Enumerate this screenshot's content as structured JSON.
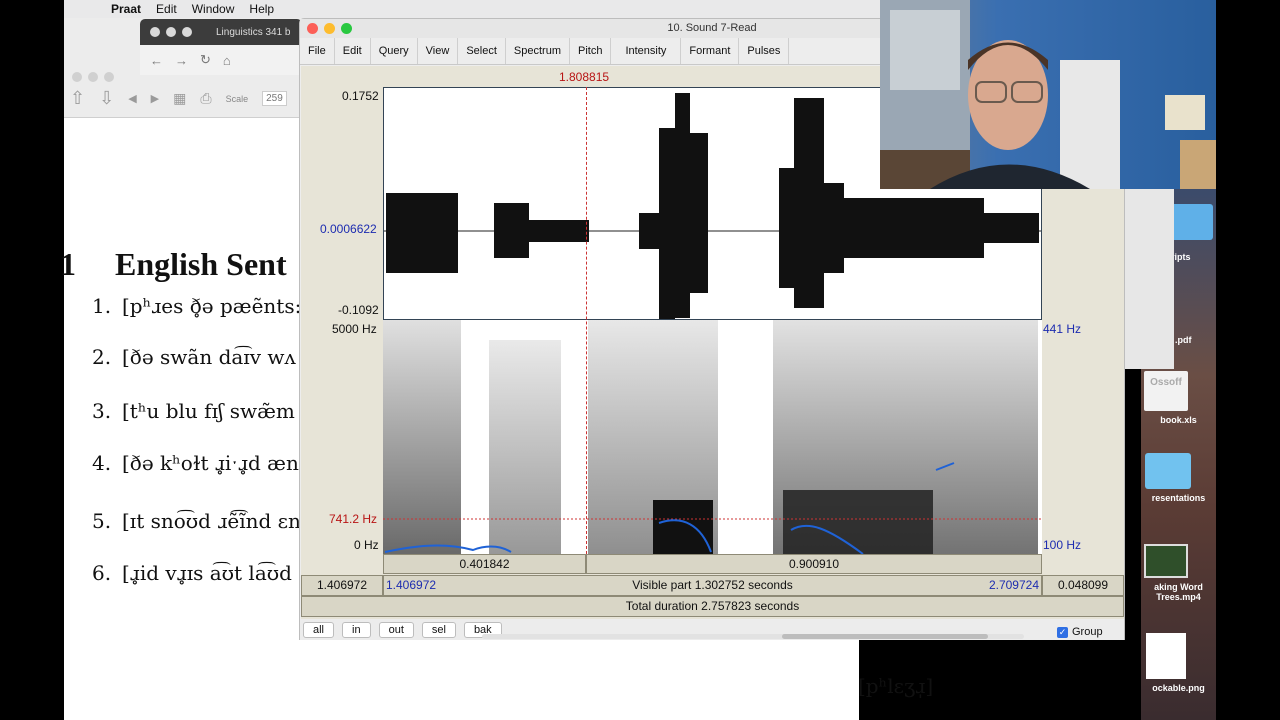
{
  "menubar": {
    "app": "Praat",
    "items": [
      "Edit",
      "Window",
      "Help"
    ]
  },
  "browser": {
    "tab_title": "Linguistics 341 b"
  },
  "doc": {
    "scale_label": "Scale",
    "scale_value": "259",
    "section_number": "1",
    "section_title": "English Sent",
    "examples": [
      {
        "n": "1.",
        "text": "[pʰɹes ð̥ə pæẽnts:"
      },
      {
        "n": "2.",
        "text": "[ðə swãn da͡ɪv wʌ"
      },
      {
        "n": "3.",
        "text": "[tʰu blu fɪʃ swæ̃m"
      },
      {
        "n": "4.",
        "text": "[ðə kʰoɫt ɹ̥iˑɹ̥d æn"
      },
      {
        "n": "5.",
        "text": "[ɪt sno͡ʊd ɹẽ͡ĩnd ɛn"
      },
      {
        "n": "6.",
        "text": "[ɹ̥id vɹ̥ɪs a͡ʊt la͡ʊd f"
      }
    ],
    "bottom_ipa": "[pʰlɛʒɹ̩]"
  },
  "praat": {
    "title": "10. Sound 7-Read",
    "menus": [
      "File",
      "Edit",
      "Query",
      "View",
      "Select",
      "Spectrum",
      "Pitch",
      "Intensity",
      "Formant",
      "Pulses"
    ],
    "cursor_time": "1.808815",
    "wave_max": "0.1752",
    "wave_cursor_value": "0.0006622",
    "wave_min": "-0.1092",
    "spec_top": "5000 Hz",
    "spec_bottom": "0 Hz",
    "spec_cursor_freq": "741.2 Hz",
    "pitch_top": "441 Hz",
    "pitch_bottom": "100 Hz",
    "seg_left": "0.401842",
    "seg_right": "0.900910",
    "visible_left_outer": "1.406972",
    "visible_left": "1.406972",
    "visible_part": "Visible part 1.302752 seconds",
    "visible_right": "2.709724",
    "visible_right_outer": "0.048099",
    "total_duration": "Total duration 2.757823 seconds",
    "buttons": [
      "all",
      "in",
      "out",
      "sel",
      "bak"
    ],
    "group_label": "Group"
  },
  "desktop": {
    "items": [
      "ripts",
      ".pdf",
      "Ossoff",
      "book.xls",
      "resentations",
      "aking Word Trees.mp4",
      "ockable.png"
    ]
  }
}
